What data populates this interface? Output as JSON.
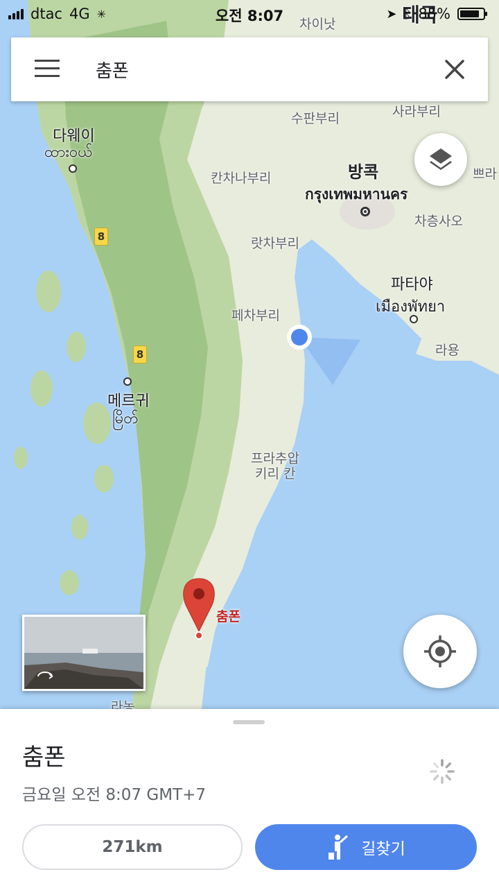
{
  "status": {
    "carrier": "dtac",
    "network": "4G",
    "time": "오전 8:07",
    "battery": "85%",
    "battery_level": 0.85
  },
  "search": {
    "query": "춤폰"
  },
  "map": {
    "labels": {
      "chaiyat": "차이낫",
      "suphanburi": "수판부리",
      "saraburi": "사라부리",
      "dawei": "다웨이",
      "dawei_burmese": "ထားဝယ်",
      "kanchanaburi": "칸차나부리",
      "bangkok": "방콕",
      "bangkok_thai": "กรุงเทพมหานคร",
      "chachoengsao": "차층사오",
      "ratchaburi": "랏차부리",
      "pattaya": "파타야",
      "pattaya_thai": "เมืองพัทยา",
      "phetchaburi": "페차부리",
      "rayong": "라용",
      "mergui": "메르귀",
      "mergui_burmese": "မြိတ်",
      "prachuap_1": "프라추압",
      "prachuap_2": "키리 칸",
      "marker_label": "춤폰",
      "bottom_partial": "라농",
      "right_partial": "쁘라",
      "top_partial": "태국"
    },
    "route_shields": [
      "8",
      "8"
    ]
  },
  "sheet": {
    "title": "춤폰",
    "subtitle": "금요일 오전 8:07 GMT+7",
    "distance": "271km",
    "directions_label": "길찾기"
  }
}
